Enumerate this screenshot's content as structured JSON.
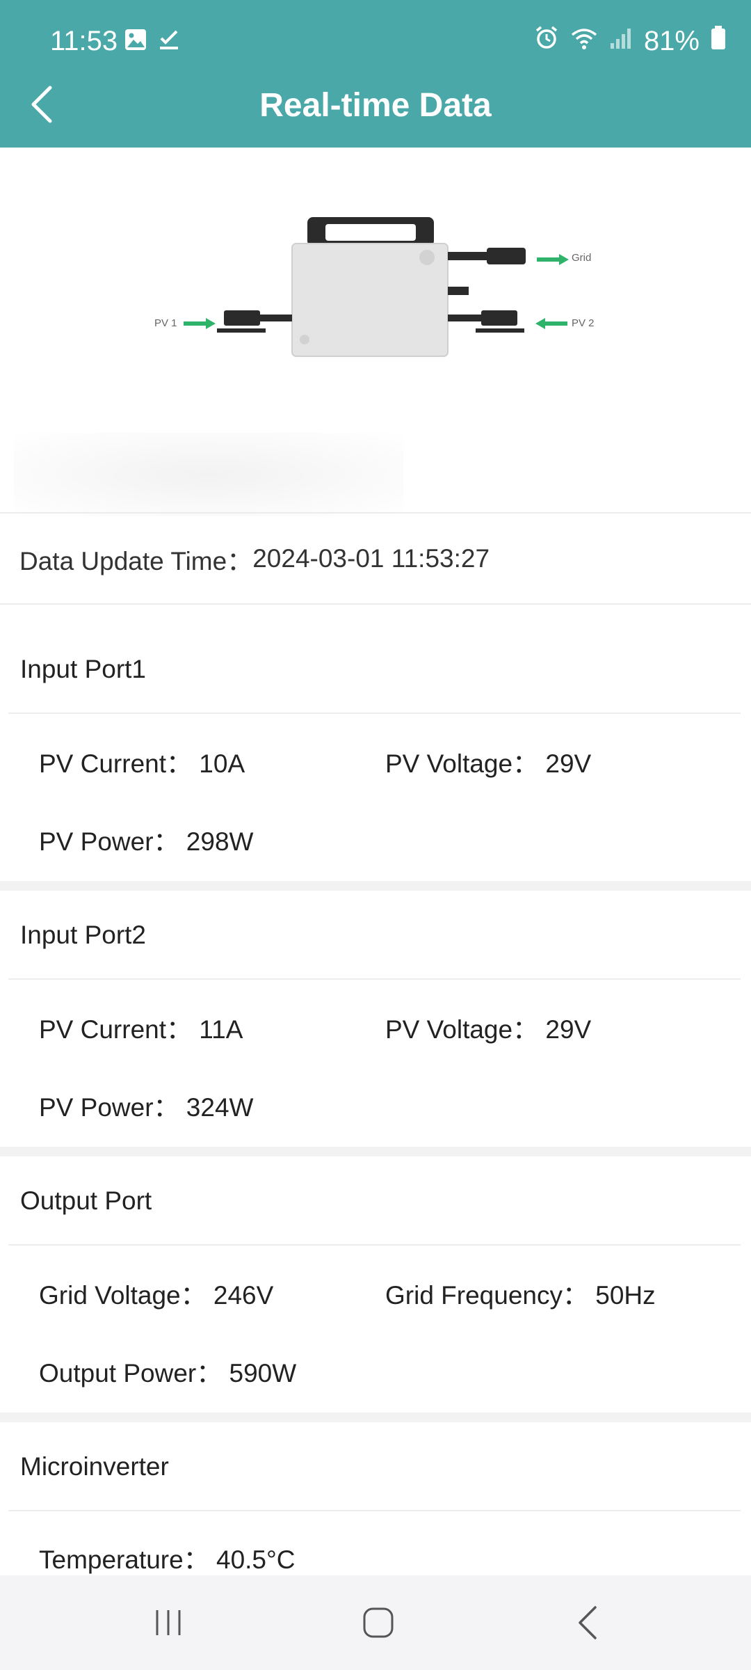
{
  "status_bar": {
    "time": "11:53",
    "battery": "81%"
  },
  "app_bar": {
    "title": "Real-time Data"
  },
  "device": {
    "label_pv1": "PV 1",
    "label_pv2": "PV 2",
    "label_grid": "Grid"
  },
  "update": {
    "label": "Data Update Time：",
    "value": "2024-03-01 11:53:27"
  },
  "input_port1": {
    "title": "Input Port1",
    "pv_current": "PV Current： 10A",
    "pv_voltage": "PV Voltage： 29V",
    "pv_power": "PV Power： 298W"
  },
  "input_port2": {
    "title": "Input Port2",
    "pv_current": "PV Current： 11A",
    "pv_voltage": "PV Voltage： 29V",
    "pv_power": "PV Power： 324W"
  },
  "output_port": {
    "title": "Output Port",
    "grid_voltage": "Grid Voltage： 246V",
    "grid_frequency": "Grid Frequency： 50Hz",
    "output_power": "Output Power： 590W"
  },
  "microinverter": {
    "title": "Microinverter",
    "temperature": "Temperature： 40.5°C"
  },
  "colors": {
    "header": "#4aa8a8",
    "arrow_green": "#2fb36b",
    "nav_bg": "#f4f4f6"
  }
}
